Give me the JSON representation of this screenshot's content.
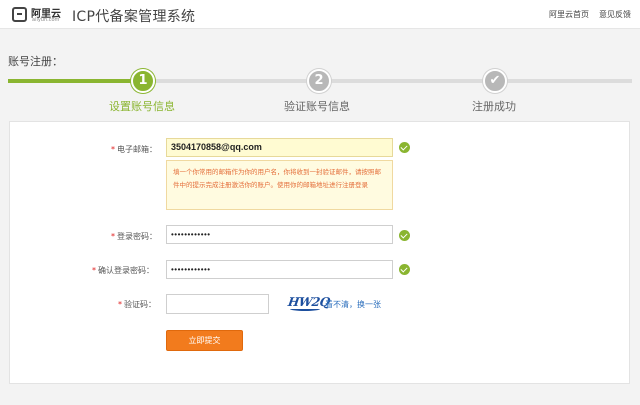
{
  "header": {
    "logo_cn": "阿里云",
    "logo_en": "aliyun.com",
    "title": "ICP代备案管理系统",
    "links": {
      "home": "阿里云首页",
      "feedback": "意见反馈"
    }
  },
  "section_title": "账号注册：",
  "steps": [
    {
      "number": "1",
      "label": "设置账号信息",
      "state": "active"
    },
    {
      "number": "2",
      "label": "验证账号信息",
      "state": "pending"
    },
    {
      "number": "✔",
      "label": "注册成功",
      "state": "pending"
    }
  ],
  "form": {
    "required_mark": "*",
    "email": {
      "label": "电子邮箱：",
      "value": "3504170858@qq.com",
      "valid": true,
      "tip": "填一个你常用的邮箱作为你的用户名，你将收到一封验证邮件，请按照邮件中的提示完成注册激活你的账户。使用你的邮箱地址进行注册登录"
    },
    "password": {
      "label": "登录密码：",
      "value": "••••••••••••",
      "valid": true
    },
    "confirm_password": {
      "label": "确认登录密码：",
      "value": "••••••••••••",
      "valid": true
    },
    "captcha": {
      "label": "验证码：",
      "value": "",
      "image_text": "HW2Q",
      "refresh_text": "看不清，换一张"
    },
    "submit_label": "立即提交"
  },
  "colors": {
    "accent_green": "#8ab530",
    "submit_orange": "#f27b1d",
    "link_blue": "#2c6fbd",
    "tip_text": "#e46e3a",
    "required_red": "#e02020"
  }
}
